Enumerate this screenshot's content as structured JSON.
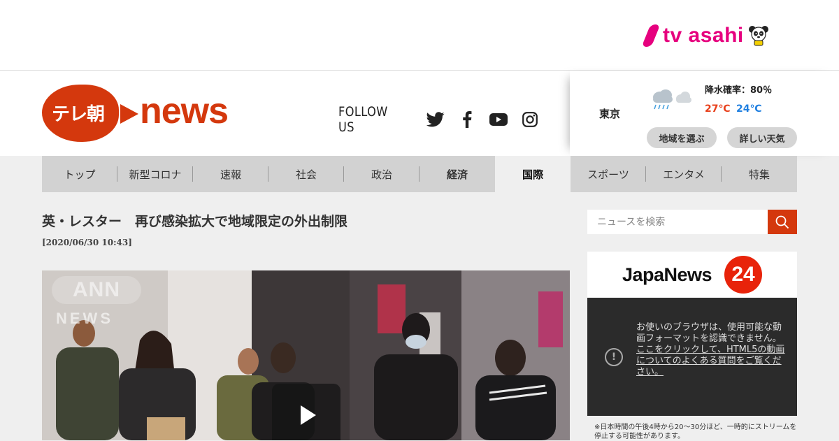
{
  "brand": {
    "tvasahi": "tv asahi"
  },
  "logo": {
    "jp": "テレ朝",
    "news": "news"
  },
  "follow": {
    "label": "FOLLOW US",
    "icons": [
      "twitter-icon",
      "facebook-icon",
      "youtube-icon",
      "instagram-icon"
    ]
  },
  "weather": {
    "city": "東京",
    "rain": "降水確率：80％",
    "high": "27℃",
    "low": "24℃",
    "btn_region": "地域を選ぶ",
    "btn_detail": "詳しい天気"
  },
  "nav": [
    "トップ",
    "新型コロナ",
    "速報",
    "社会",
    "政治",
    "経済",
    "国際",
    "スポーツ",
    "エンタメ",
    "特集"
  ],
  "nav_active": "国際",
  "article": {
    "title": "英・レスター　再び感染拡大で地域限定の外出制限",
    "date": "[2020/06/30 10:43]"
  },
  "video": {
    "ann": "ANN",
    "news": "NEWS"
  },
  "search": {
    "placeholder": "ニュースを検索"
  },
  "japanews": {
    "title": "JapaNews",
    "num": "24"
  },
  "player": {
    "msg1": "お使いのブラウザは、使用可能な動画フォーマットを認識できません。",
    "msg2": "ここをクリックして、HTML5の動画についてのよくある質問をご覧ください。"
  },
  "note": "※日本時間の午後4時から20～30分ほど、一時的にストリームを停止する可能性があります。",
  "colors": {
    "brand_red": "#d4380d",
    "tvasahi_pink": "#e6007e",
    "temp_high": "#e8401c",
    "temp_low": "#1f7fe0"
  }
}
